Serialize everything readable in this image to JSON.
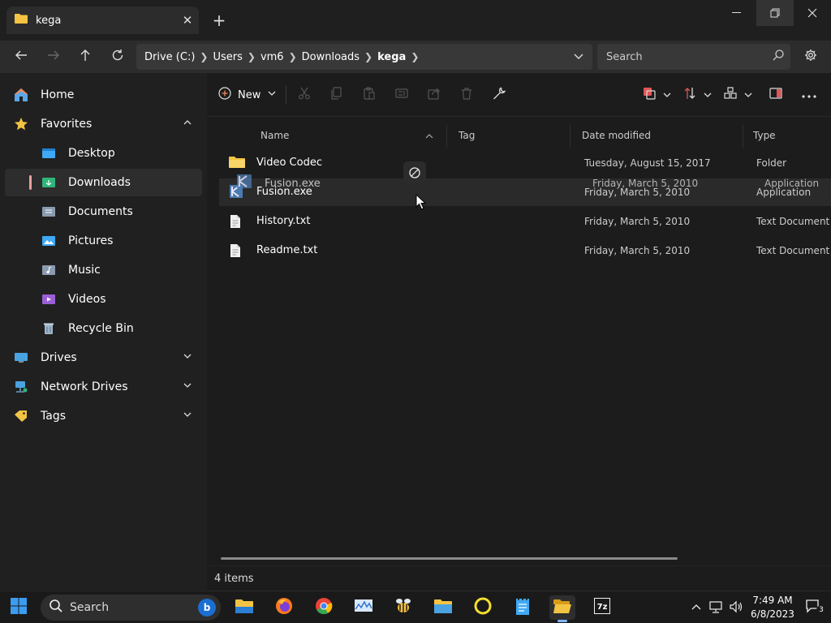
{
  "window": {
    "tab_title": "kega",
    "tab_close_icon": "close-icon",
    "new_tab_label": "+"
  },
  "address": {
    "crumbs": [
      "Drive (C:)",
      "Users",
      "vm6",
      "Downloads",
      "kega"
    ]
  },
  "search": {
    "placeholder": "Search"
  },
  "sidebar": {
    "items": [
      {
        "label": "Home",
        "icon": "home-icon"
      },
      {
        "label": "Favorites",
        "icon": "star-icon"
      },
      {
        "label": "Desktop",
        "icon": "desktop-folder-icon"
      },
      {
        "label": "Downloads",
        "icon": "downloads-folder-icon"
      },
      {
        "label": "Documents",
        "icon": "documents-folder-icon"
      },
      {
        "label": "Pictures",
        "icon": "pictures-folder-icon"
      },
      {
        "label": "Music",
        "icon": "music-folder-icon"
      },
      {
        "label": "Videos",
        "icon": "videos-folder-icon"
      },
      {
        "label": "Recycle Bin",
        "icon": "recycle-bin-icon"
      },
      {
        "label": "Drives",
        "icon": "drive-icon"
      },
      {
        "label": "Network Drives",
        "icon": "network-drive-icon"
      },
      {
        "label": "Tags",
        "icon": "tag-icon"
      }
    ]
  },
  "toolbar": {
    "new_label": "New"
  },
  "columns": {
    "name": "Name",
    "tag": "Tag",
    "date": "Date modified",
    "type": "Type"
  },
  "files": [
    {
      "name": "Video Codec",
      "date": "Tuesday, August 15, 2017",
      "type": "Folder",
      "icon": "folder-icon"
    },
    {
      "name": "Fusion.exe",
      "date": "Friday, March 5, 2010",
      "type": "Application",
      "icon": "kega-app-icon"
    },
    {
      "name": "History.txt",
      "date": "Friday, March 5, 2010",
      "type": "Text Document",
      "icon": "text-file-icon"
    },
    {
      "name": "Readme.txt",
      "date": "Friday, March 5, 2010",
      "type": "Text Document",
      "icon": "text-file-icon"
    }
  ],
  "drag_ghost": {
    "name": "Fusion.exe",
    "date": "Friday, March 5, 2010",
    "type": "Application"
  },
  "status": {
    "item_count": "4 items"
  },
  "taskbar": {
    "search_placeholder": "Search",
    "bing_label": "b",
    "time": "7:49 AM",
    "date": "6/8/2023",
    "notification_count": "3"
  },
  "colors": {
    "accent": "#7fb5ff",
    "folder": "#f3c443",
    "selection_bar": "#e8a0a0"
  }
}
